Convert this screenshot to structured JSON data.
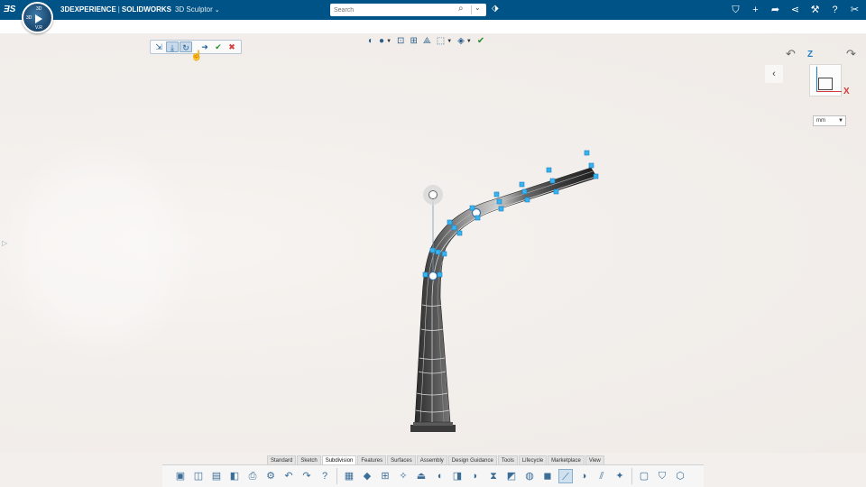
{
  "header": {
    "brand_bold": "3DEXPERIENCE",
    "brand_sep": "|",
    "brand_product": "SOLIDWORKS",
    "app_name": "3D Sculptor",
    "search_placeholder": "Search",
    "compass_labels": {
      "top": "3D",
      "left": "3D",
      "bottom": "V.R"
    },
    "right_icons": [
      "user-share-icon",
      "add-icon",
      "share-icon",
      "network-icon",
      "apps-icon",
      "help-icon",
      "tools-icon"
    ]
  },
  "sculpt_toolbar": {
    "buttons": [
      "move-icon",
      "pull-icon",
      "rotate-icon",
      "next-icon",
      "ok-icon",
      "cancel-icon"
    ]
  },
  "view_toolbar": {
    "buttons": [
      "display-style-icon",
      "appearance-icon",
      "zoom-fit-icon",
      "section-view-icon",
      "view-selector-icon",
      "hide-show-icon",
      "rebuild-icon"
    ]
  },
  "navigation": {
    "z_label": "Z",
    "x_label": "X",
    "units": "mm"
  },
  "command_tabs": [
    {
      "label": "Standard",
      "active": false
    },
    {
      "label": "Sketch",
      "active": false
    },
    {
      "label": "Subdivision",
      "active": true
    },
    {
      "label": "Features",
      "active": false
    },
    {
      "label": "Surfaces",
      "active": false
    },
    {
      "label": "Assembly",
      "active": false
    },
    {
      "label": "Design Guidance",
      "active": false
    },
    {
      "label": "Tools",
      "active": false
    },
    {
      "label": "Lifecycle",
      "active": false
    },
    {
      "label": "Marketplace",
      "active": false
    },
    {
      "label": "View",
      "active": false
    }
  ],
  "command_icons": [
    "new-icon",
    "open-icon",
    "save-icon",
    "save-as-icon",
    "print-icon",
    "settings-icon",
    "undo-icon",
    "redo-icon",
    "help-icon",
    "table-icon",
    "box-icon",
    "grid-icon",
    "vertex-icon",
    "plane-icon",
    "extrude-icon",
    "revolve-icon",
    "sweep-icon",
    "loft-icon",
    "face-icon",
    "shell-icon",
    "cube-icon",
    "sculpt-icon",
    "sphere-icon",
    "bend-icon",
    "twist-icon",
    "part-icon",
    "cloth-icon",
    "mesh-icon"
  ]
}
